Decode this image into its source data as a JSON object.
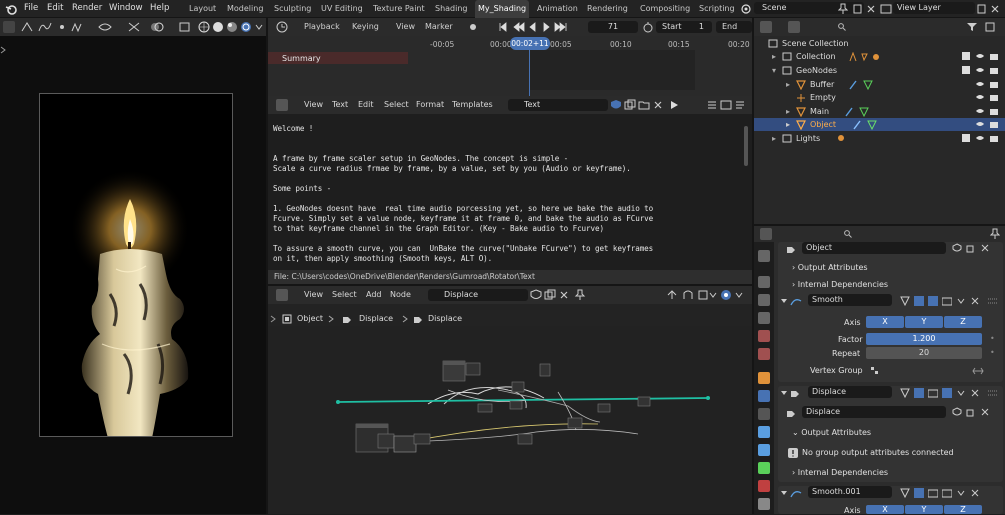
{
  "menu": [
    "File",
    "Edit",
    "Render",
    "Window",
    "Help"
  ],
  "workspaces": [
    "Layout",
    "Modeling",
    "Sculpting",
    "UV Editing",
    "Texture Paint",
    "Shading",
    "My_Shading",
    "Animation",
    "Rendering",
    "Compositing",
    "Scripting"
  ],
  "active_workspace": "My_Shading",
  "scene": "Scene",
  "view_layer": "View Layer",
  "timeline": {
    "playback": "Playback",
    "keying": "Keying",
    "view": "View",
    "marker": "Marker",
    "current_frame": "71",
    "start_label": "Start",
    "start": "1",
    "end_label": "End",
    "playhead_time": "00:02+11",
    "ticks": [
      "-00:05",
      "00:00",
      "00:05",
      "00:10",
      "00:15",
      "00:20"
    ],
    "summary": "Summary"
  },
  "text_editor": {
    "menus": [
      "View",
      "Text",
      "Edit",
      "Select",
      "Format",
      "Templates"
    ],
    "text_name": "Text",
    "lines": [
      "Welcome !",
      "",
      "",
      "A frame by frame scaler setup in GeoNodes. The concept is simple -",
      "Scale a curve radius frmae by frame, by a value, set by you (Audio or keyframe).",
      "",
      "Some points -",
      "",
      "1. GeoNodes doesnt have  real time audio porcessing yet, so here we bake the audio to",
      "Fcurve. Simply set a value node, keyframe it at frame 0, and bake the audio as FCurve",
      "to that keyframe channel in the Graph Editor. (Key - Bake audio to Fcurve)",
      "",
      "To assure a smooth curve, you can  UnBake the curve(\"Unbake FCurve\") to get keyframes",
      "on it, then apply smoothing (Smooth keys, ALT O)."
    ],
    "file_path": "File: C:\\Users\\codes\\OneDrive\\Blender\\Renders\\Gumroad\\Rotator\\Text"
  },
  "node_editor": {
    "menus": [
      "View",
      "Select",
      "Add",
      "Node"
    ],
    "tree_name": "Displace",
    "breadcrumb": [
      "Object",
      "Displace",
      "Displace"
    ]
  },
  "outliner": {
    "root": "Scene Collection",
    "items": [
      {
        "label": "Collection",
        "indent": 1,
        "selected": false
      },
      {
        "label": "GeoNodes",
        "indent": 1,
        "selected": false
      },
      {
        "label": "Buffer",
        "indent": 2,
        "selected": false
      },
      {
        "label": "Empty",
        "indent": 2,
        "selected": false
      },
      {
        "label": "Main",
        "indent": 2,
        "selected": false
      },
      {
        "label": "Object",
        "indent": 2,
        "selected": true
      },
      {
        "label": "Lights",
        "indent": 1,
        "selected": false
      }
    ]
  },
  "properties": {
    "object_name": "Object",
    "output_attributes": "Output Attributes",
    "internal_dependencies": "Internal Dependencies",
    "smooth_name": "Smooth",
    "axis_label": "Axis",
    "axes": [
      "X",
      "Y",
      "Z"
    ],
    "factor_label": "Factor",
    "factor": "1.200",
    "repeat_label": "Repeat",
    "repeat": "20",
    "vertex_group_label": "Vertex Group",
    "displace_mod_name": "Displace",
    "displace_tree": "Displace",
    "no_group_output": "No group output attributes connected",
    "smooth2_name": "Smooth.001",
    "axis2_label": "Axis"
  },
  "colors": {
    "accent": "#4772b3",
    "selection": "#334d80",
    "playhead": "#4772b3"
  }
}
